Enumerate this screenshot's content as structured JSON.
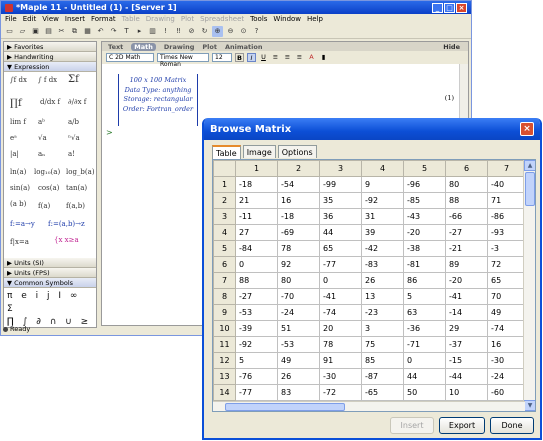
{
  "maple": {
    "title": "*Maple 11 - Untitled (1) - [Server 1]",
    "menu": [
      "File",
      "Edit",
      "View",
      "Insert",
      "Format",
      "Table",
      "Drawing",
      "Plot",
      "Spreadsheet",
      "Tools",
      "Window",
      "Help"
    ],
    "menu_disabled": [
      false,
      false,
      false,
      false,
      false,
      true,
      true,
      true,
      true,
      false,
      false,
      false
    ],
    "palettes": {
      "favorites": "Favorites",
      "handwriting": "Handwriting",
      "expression": "Expression",
      "units_si": "Units (SI)",
      "units_fps": "Units (FPS)",
      "common_symbols": "Common Symbols",
      "symbols_row1": "π e i j I ∞ Σ",
      "symbols_row2": "∏ ∫ ∂ ∩ ∪ ≥ >"
    },
    "context_tabs": [
      "Text",
      "Math",
      "Drawing",
      "Plot",
      "Animation"
    ],
    "hide_label": "Hide",
    "format": {
      "mode": "C 2D Math",
      "font": "Times New Roman",
      "size": "12"
    },
    "matrix_summary": [
      "100 x 100 Matrix",
      "Data Type: anything",
      "Storage: rectangular",
      "Order: Fortran_order"
    ],
    "equation_label": "(1)",
    "prompt": ">",
    "status": "Ready"
  },
  "dialog": {
    "title": "Browse Matrix",
    "tabs": [
      "Table",
      "Image",
      "Options"
    ],
    "columns": [
      "1",
      "2",
      "3",
      "4",
      "5",
      "6",
      "7"
    ],
    "rows": [
      {
        "h": "1",
        "c": [
          "-18",
          "-54",
          "-99",
          "9",
          "-96",
          "80",
          "-40"
        ]
      },
      {
        "h": "2",
        "c": [
          "21",
          "16",
          "35",
          "-92",
          "-85",
          "88",
          "71"
        ]
      },
      {
        "h": "3",
        "c": [
          "-11",
          "-18",
          "36",
          "31",
          "-43",
          "-66",
          "-86"
        ]
      },
      {
        "h": "4",
        "c": [
          "27",
          "-69",
          "44",
          "39",
          "-20",
          "-27",
          "-93"
        ]
      },
      {
        "h": "5",
        "c": [
          "-84",
          "78",
          "65",
          "-42",
          "-38",
          "-21",
          "-3"
        ]
      },
      {
        "h": "6",
        "c": [
          "0",
          "92",
          "-77",
          "-83",
          "-81",
          "89",
          "72"
        ]
      },
      {
        "h": "7",
        "c": [
          "88",
          "80",
          "0",
          "26",
          "86",
          "-20",
          "65"
        ]
      },
      {
        "h": "8",
        "c": [
          "-27",
          "-70",
          "-41",
          "13",
          "5",
          "-41",
          "70"
        ]
      },
      {
        "h": "9",
        "c": [
          "-53",
          "-24",
          "-74",
          "-23",
          "63",
          "-14",
          "49"
        ]
      },
      {
        "h": "10",
        "c": [
          "-39",
          "51",
          "20",
          "3",
          "-36",
          "29",
          "-74"
        ]
      },
      {
        "h": "11",
        "c": [
          "-92",
          "-53",
          "78",
          "75",
          "-71",
          "-37",
          "16"
        ]
      },
      {
        "h": "12",
        "c": [
          "5",
          "49",
          "91",
          "85",
          "0",
          "-15",
          "-30"
        ]
      },
      {
        "h": "13",
        "c": [
          "-76",
          "26",
          "-30",
          "-87",
          "44",
          "-44",
          "-24"
        ]
      },
      {
        "h": "14",
        "c": [
          "-77",
          "83",
          "-72",
          "-65",
          "50",
          "10",
          "-60"
        ]
      }
    ],
    "buttons": {
      "insert": "Insert",
      "export": "Export",
      "done": "Done"
    }
  }
}
